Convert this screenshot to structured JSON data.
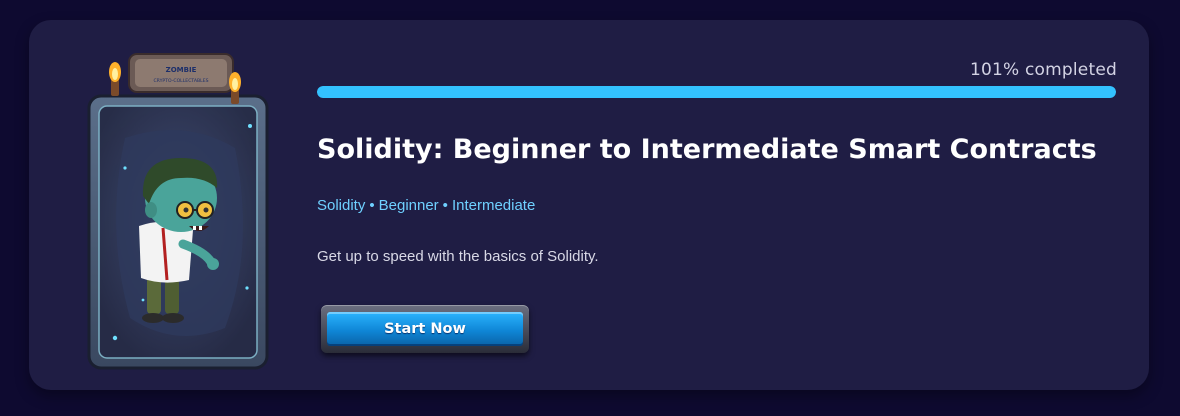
{
  "course": {
    "progress_text": "101% completed",
    "progress_fraction": 1.0,
    "title": "Solidity: Beginner to Intermediate Smart Contracts",
    "tags": [
      "Solidity",
      "Beginner",
      "Intermediate"
    ],
    "tag_separator": "•",
    "description": "Get up to speed with the basics of Solidity.",
    "start_label": "Start Now"
  },
  "card_art": {
    "banner_line1": "ZOMBIE",
    "banner_line2": "CRYPTO-COLLECTABLES",
    "icon": "zombie-character"
  },
  "colors": {
    "page_bg": "#0e0a30",
    "card_bg": "#1f1d44",
    "progress_fill": "#33c2ff",
    "tag_color": "#6fd0ff",
    "button_blue": "#1b9eea"
  }
}
